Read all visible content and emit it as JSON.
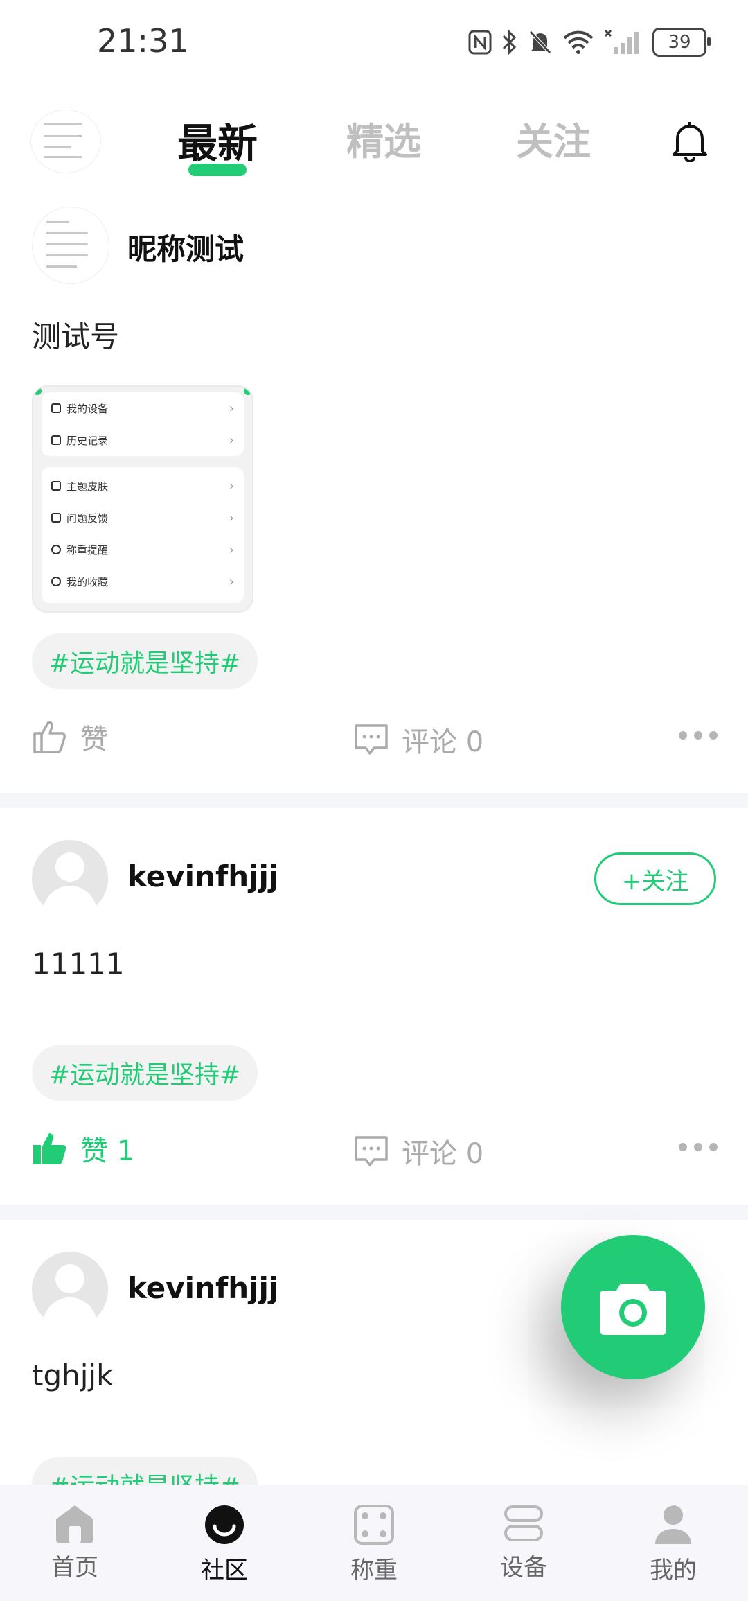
{
  "status_bar": {
    "time": "21:31",
    "battery": "39"
  },
  "header": {
    "tabs": [
      {
        "label": "最新",
        "active": true
      },
      {
        "label": "精选",
        "active": false
      },
      {
        "label": "关注",
        "active": false
      }
    ],
    "notification_icon": "bell-icon"
  },
  "posts": [
    {
      "nickname": "昵称测试",
      "text": "测试号",
      "image_menu": [
        {
          "label": "我的设备"
        },
        {
          "label": "历史记录"
        },
        {
          "label": "主题皮肤"
        },
        {
          "label": "问题反馈"
        },
        {
          "label": "称重提醒"
        },
        {
          "label": "我的收藏"
        }
      ],
      "tag": "#运动就是坚持#",
      "like_label": "赞",
      "comment_label": "评论 0"
    },
    {
      "nickname": "kevinfhjjj",
      "follow_label": "+关注",
      "text": "11111",
      "tag": "#运动就是坚持#",
      "like_label": "赞 1",
      "comment_label": "评论 0"
    },
    {
      "nickname": "kevinfhjjj",
      "text": "tghjjk",
      "tag": "#运动就是坚持#"
    }
  ],
  "fab_icon": "camera-icon",
  "bottom_nav": [
    {
      "label": "首页",
      "icon": "home-icon"
    },
    {
      "label": "社区",
      "icon": "community-icon",
      "active": true
    },
    {
      "label": "称重",
      "icon": "scale-icon"
    },
    {
      "label": "设备",
      "icon": "device-icon"
    },
    {
      "label": "我的",
      "icon": "profile-icon"
    }
  ],
  "colors": {
    "accent": "#22cc77",
    "inactive_tab": "#bfbfbf",
    "divider": "#f4f6fa"
  }
}
